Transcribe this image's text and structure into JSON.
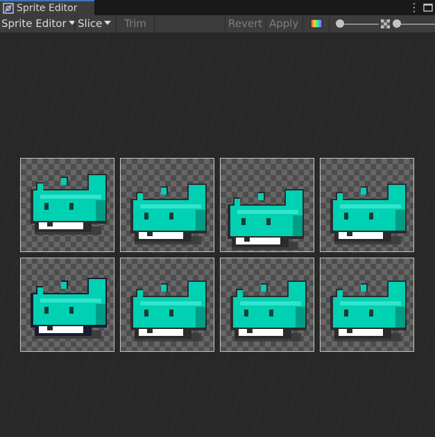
{
  "window": {
    "tab_title": "Sprite Editor",
    "tab_icon": "sprite-editor-icon",
    "menu_icon": "kebab-menu-icon",
    "maximize_icon": "maximize-icon"
  },
  "toolbar": {
    "mode_dropdown": "Sprite Editor",
    "slice_dropdown": "Slice",
    "trim_label": "Trim",
    "revert_label": "Revert",
    "apply_label": "Apply",
    "color_channel_icon": "rgb-channel-icon",
    "zoom_level": 0.0,
    "mip_icon": "checker-alpha-icon",
    "mip_level": 0.0
  },
  "sprite_sheet": {
    "rows": 2,
    "columns": 4,
    "frames": [
      {
        "name": "frame-0",
        "variant": "a"
      },
      {
        "name": "frame-1",
        "variant": "b"
      },
      {
        "name": "frame-2",
        "variant": "c"
      },
      {
        "name": "frame-3",
        "variant": "b"
      },
      {
        "name": "frame-4",
        "variant": "d"
      },
      {
        "name": "frame-5",
        "variant": "e"
      },
      {
        "name": "frame-6",
        "variant": "e"
      },
      {
        "name": "frame-7",
        "variant": "e"
      }
    ],
    "colors": {
      "body": "#00d1b2",
      "highlight": "#33e4cc",
      "shade": "#009e86",
      "outline": "#2b2b2b",
      "dark_outline": "#1a1a33",
      "mouth": "#ffffff",
      "eye": "#1d3b36",
      "shadow": "#3a3f3d"
    }
  }
}
